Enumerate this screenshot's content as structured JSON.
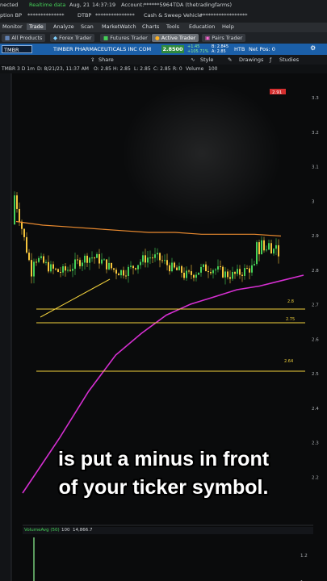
{
  "status": {
    "connected": "nected",
    "data": "Realtime data",
    "date": "Aug, 21",
    "time": "14:37:19",
    "account_label": "Account:",
    "account_value": "******5964TDA (thetradingfarms)",
    "option_bp": "ption BP",
    "option_bp_value": "**************",
    "dtbp": "DTBP",
    "dtbp_value": "***************",
    "cash_sweep": "Cash & Sweep Vehicle",
    "cash_sweep_value": "******************"
  },
  "menu": {
    "items": [
      "Monitor",
      "Trade",
      "Analyze",
      "Scan",
      "MarketWatch",
      "Charts",
      "Tools",
      "Education",
      "Help"
    ],
    "active": "Trade"
  },
  "subtabs": {
    "items": [
      "All Products",
      "Forex Trader",
      "Futures Trader",
      "Active Trader",
      "Pairs Trader"
    ],
    "active": "Active Trader"
  },
  "symbol": {
    "ticker": "TMBR",
    "name": "TIMBER PHARMACEUTICALS INC COM",
    "last": "2.8500",
    "change": "+1.45",
    "change_pct": "+105.71%",
    "bid": "B: 2.845",
    "ask": "A: 2.85",
    "htb": "HTB",
    "net_pos": "Net Pos: 0"
  },
  "toolbar": {
    "share": "Share",
    "style": "Style",
    "drawings": "Drawings",
    "studies": "Studies"
  },
  "chartinfo": {
    "symbol_tf": "TMBR 3 D 1m",
    "date": "D: 8/21/23, 11:37 AM",
    "open": "O: 2.85",
    "high": "H: 2.85",
    "low": "L: 2.85",
    "close": "C: 2.85",
    "range": "R: 0",
    "volume_label": "Volume",
    "volume_value": "100"
  },
  "price_tags": {
    "top": "2.91",
    "level_a": "2.8",
    "level_b": "2.75",
    "level_c": "2.64"
  },
  "volume_panel": {
    "label": "VolumeAvg (50)",
    "v1": "100",
    "v2": "14,866.7"
  },
  "colors": {
    "candle_up": "#45d058",
    "candle_down": "#f4c43c",
    "ma_orange": "#e98a2f",
    "vwap_magenta": "#d62fd2",
    "level_yellow": "#f2d23c",
    "symbolbar_blue": "#1b5fa8"
  },
  "chart_data": {
    "type": "line",
    "y_ticks": [
      "3.3",
      "3.2",
      "3.1",
      "3",
      "2.9",
      "2.8",
      "2.7",
      "2.6",
      "2.5",
      "2.4",
      "2.3",
      "2.2"
    ],
    "ylim": [
      2.2,
      3.3
    ],
    "volume_ticks": [
      "1.4",
      "1.2",
      "1"
    ],
    "horizontal_levels": [
      2.8,
      2.75,
      2.64
    ],
    "series": [
      {
        "values": [
          2.93,
          2.92,
          2.915,
          2.91,
          2.905,
          2.9,
          2.9,
          2.895,
          2.895,
          2.895,
          2.89
        ]
      },
      {
        "values": [
          2.2,
          2.35,
          2.48,
          2.58,
          2.64,
          2.69,
          2.72,
          2.74,
          2.76,
          2.77,
          2.785,
          2.8
        ]
      }
    ]
  },
  "caption": {
    "line1": "is put a minus in front",
    "line2": "of your ticker symbol."
  }
}
